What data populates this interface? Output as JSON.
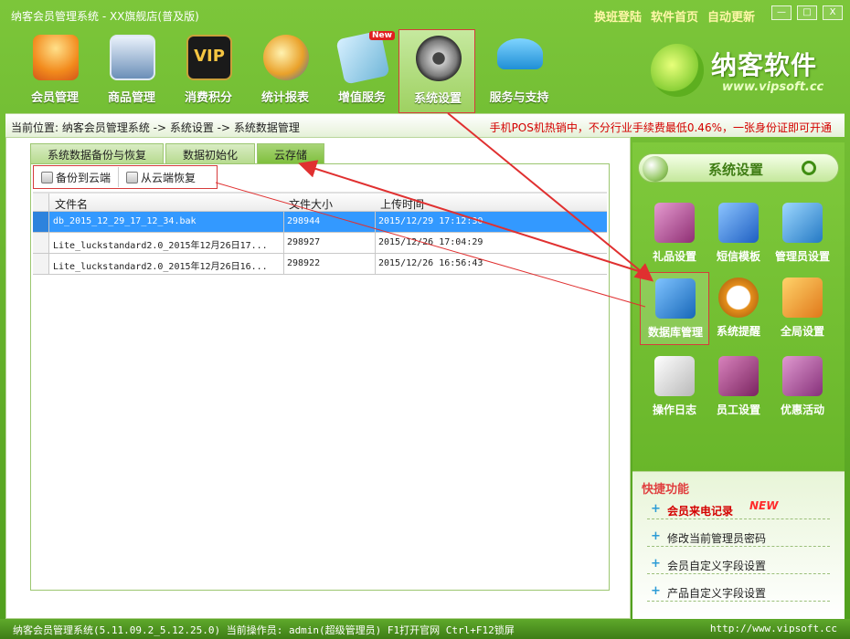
{
  "window": {
    "title": "纳客会员管理系统 - XX旗舰店(普及版)",
    "top_links": [
      "换班登陆",
      "软件首页",
      "自动更新"
    ],
    "controls": [
      "—",
      "□",
      "X"
    ]
  },
  "toolbar": {
    "items": [
      {
        "label": "会员管理",
        "icon": "members-icon"
      },
      {
        "label": "商品管理",
        "icon": "computer-icon"
      },
      {
        "label": "消费积分",
        "icon": "vip-icon"
      },
      {
        "label": "统计报表",
        "icon": "globe-clock-icon"
      },
      {
        "label": "增值服务",
        "icon": "card-new-icon",
        "badge": "New"
      },
      {
        "label": "系统设置",
        "icon": "gear-icon",
        "active": true
      },
      {
        "label": "服务与支持",
        "icon": "umbrella-icon"
      }
    ]
  },
  "brand": {
    "name": "纳客软件",
    "url": "www.vipsoft.cc"
  },
  "breadcrumb": "当前位置: 纳客会员管理系统 -> 系统设置 -> 系统数据管理",
  "promo": "手机POS机热销中，不分行业手续费最低0.46%，一张身份证即可开通",
  "tabs": [
    "系统数据备份与恢复",
    "数据初始化",
    "云存储"
  ],
  "active_tab": 2,
  "subtoolbar": {
    "backup": "备份到云端",
    "restore": "从云端恢复"
  },
  "grid": {
    "columns": [
      "文件名",
      "文件大小",
      "上传时间"
    ],
    "rows": [
      {
        "name": "db_2015_12_29_17_12_34.bak",
        "size": "298944",
        "time": "2015/12/29 17:12:30",
        "selected": true
      },
      {
        "name": "Lite_luckstandard2.0_2015年12月26日17...",
        "size": "298927",
        "time": "2015/12/26 17:04:29"
      },
      {
        "name": "Lite_luckstandard2.0_2015年12月26日16...",
        "size": "298922",
        "time": "2015/12/26 16:56:43"
      }
    ]
  },
  "side": {
    "title": "系统设置",
    "icons": [
      {
        "label": "礼品设置",
        "icon": "gift-icon",
        "color": "#b04a8f"
      },
      {
        "label": "短信模板",
        "icon": "sms-icon",
        "color": "#2b6fd6"
      },
      {
        "label": "管理员设置",
        "icon": "admin-icon",
        "color": "#2a86cf"
      },
      {
        "label": "数据库管理",
        "icon": "database-icon",
        "color": "#1d78c7",
        "highlight": true
      },
      {
        "label": "系统提醒",
        "icon": "clock-icon",
        "color": "#e48a1a"
      },
      {
        "label": "全局设置",
        "icon": "globe-icon",
        "color": "#f0a21c"
      },
      {
        "label": "操作日志",
        "icon": "log-icon",
        "color": "#cfcfcf"
      },
      {
        "label": "员工设置",
        "icon": "staff-icon",
        "color": "#9b3a7b"
      },
      {
        "label": "优惠活动",
        "icon": "promo-icon",
        "color": "#a34a8e"
      }
    ]
  },
  "quick": {
    "title": "快捷功能",
    "items": [
      {
        "label": "会员来电记录",
        "hot": true,
        "badge": "NEW"
      },
      {
        "label": "修改当前管理员密码"
      },
      {
        "label": "会员自定义字段设置"
      },
      {
        "label": "产品自定义字段设置"
      }
    ]
  },
  "status": {
    "left": "纳客会员管理系统(5.11.09.2_5.12.25.0) 当前操作员: admin(超级管理员) F1打开官网 Ctrl+F12锁屏",
    "right": "http://www.vipsoft.cc"
  },
  "colors": {
    "accent_green": "#5fae22",
    "highlight_red": "#d63b3b",
    "selection_blue": "#3399ff"
  }
}
